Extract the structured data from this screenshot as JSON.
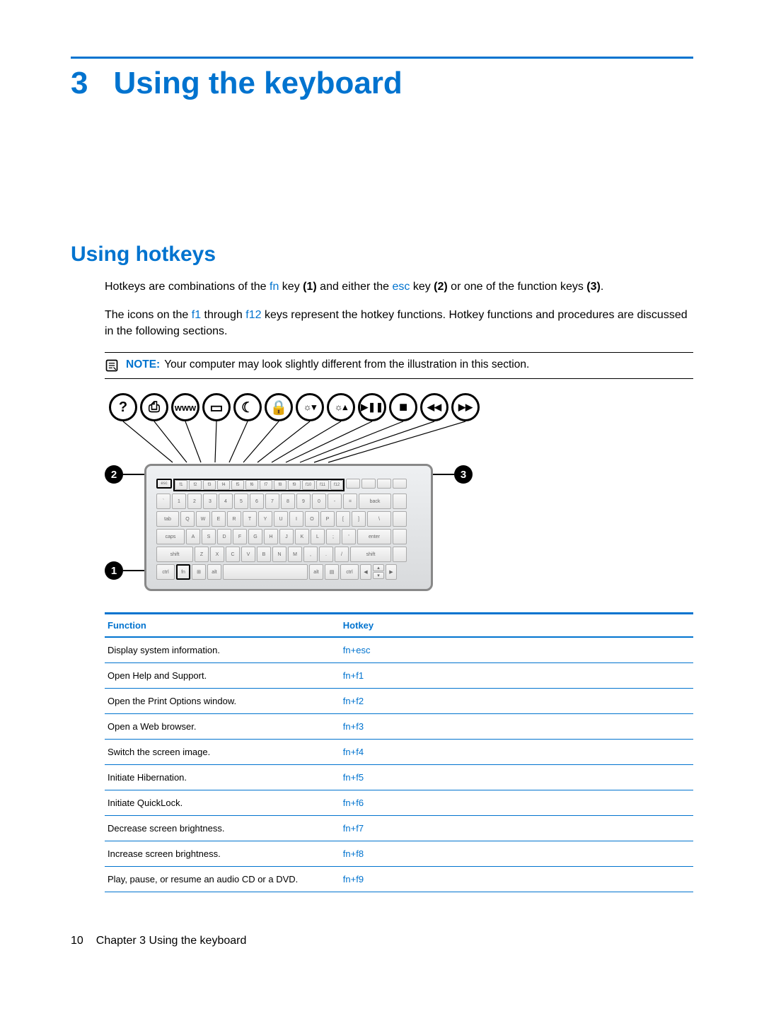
{
  "chapter": {
    "number": "3",
    "title": "Using the keyboard"
  },
  "section": {
    "title": "Using hotkeys"
  },
  "para1": {
    "t1": "Hotkeys are combinations of the ",
    "fn": "fn",
    "t2": " key ",
    "b1": "(1)",
    "t3": " and either the ",
    "esc": "esc",
    "t4": " key ",
    "b2": "(2)",
    "t5": " or one of the function keys ",
    "b3": "(3)",
    "t6": "."
  },
  "para2": {
    "t1": "The icons on the ",
    "f1": "f1",
    "t2": " through ",
    "f12": "f12",
    "t3": " keys represent the hotkey functions. Hotkey functions and procedures are discussed in the following sections."
  },
  "note": {
    "label": "NOTE:",
    "text": "Your computer may look slightly different from the illustration in this section."
  },
  "icons": [
    "?",
    "⎙",
    "www",
    "▭",
    "☾",
    "🔒",
    "☼▾",
    "☼▴",
    "▶❚❚",
    "■",
    "◀◀",
    "▶▶"
  ],
  "callouts": {
    "one": "1",
    "two": "2",
    "three": "3"
  },
  "table": {
    "headers": {
      "function": "Function",
      "hotkey": "Hotkey"
    },
    "rows": [
      {
        "function": "Display system information.",
        "hotkey": "fn+esc"
      },
      {
        "function": "Open Help and Support.",
        "hotkey": "fn+f1"
      },
      {
        "function": "Open the Print Options window.",
        "hotkey": "fn+f2"
      },
      {
        "function": "Open a Web browser.",
        "hotkey": "fn+f3"
      },
      {
        "function": "Switch the screen image.",
        "hotkey": "fn+f4"
      },
      {
        "function": "Initiate Hibernation.",
        "hotkey": "fn+f5"
      },
      {
        "function": "Initiate QuickLock.",
        "hotkey": "fn+f6"
      },
      {
        "function": "Decrease screen brightness.",
        "hotkey": "fn+f7"
      },
      {
        "function": "Increase screen brightness.",
        "hotkey": "fn+f8"
      },
      {
        "function": "Play, pause, or resume an audio CD or a DVD.",
        "hotkey": "fn+f9"
      }
    ]
  },
  "footer": {
    "page_number": "10",
    "chapter_label": "Chapter 3   Using the keyboard"
  }
}
